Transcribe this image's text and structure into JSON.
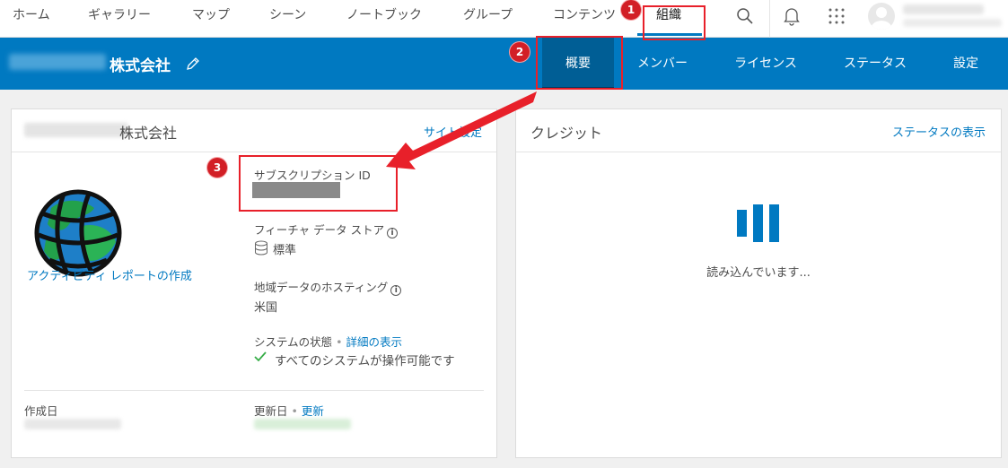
{
  "nav": {
    "items": [
      {
        "label": "ホーム",
        "name": "nav-home"
      },
      {
        "label": "ギャラリー",
        "name": "nav-gallery"
      },
      {
        "label": "マップ",
        "name": "nav-map"
      },
      {
        "label": "シーン",
        "name": "nav-scene"
      },
      {
        "label": "ノートブック",
        "name": "nav-notebook"
      },
      {
        "label": "グループ",
        "name": "nav-groups"
      },
      {
        "label": "コンテンツ",
        "name": "nav-content"
      },
      {
        "label": "組織",
        "name": "nav-organization"
      }
    ],
    "active": "組織",
    "icons": [
      "search-icon",
      "bell-icon",
      "apps-grid-icon"
    ]
  },
  "orgbar": {
    "org_name": "株式会社",
    "edit_icon": "pencil-icon",
    "tabs": [
      {
        "label": "概要",
        "active": true
      },
      {
        "label": "メンバー",
        "active": false
      },
      {
        "label": "ライセンス",
        "active": false
      },
      {
        "label": "ステータス",
        "active": false
      },
      {
        "label": "設定",
        "active": false
      }
    ]
  },
  "left_card": {
    "title": "株式会社",
    "site_settings_link": "サイト設定",
    "activity_link": "アクティビティ レポートの作成",
    "subscription_id_label": "サブスクリプション ID",
    "feature_store_label": "フィーチャ データ ストア",
    "feature_store_value": "標準",
    "hosting_label": "地域データのホスティング",
    "hosting_value": "米国",
    "system_status_label": "システムの状態",
    "system_status_link": "詳細の表示",
    "system_status_value": "すべてのシステムが操作可能です",
    "created_label": "作成日",
    "updated_label": "更新日",
    "update_link": "更新"
  },
  "right_card": {
    "title": "クレジット",
    "status_link": "ステータスの表示",
    "loading_text": "読み込んでいます..."
  },
  "annotations": [
    "1",
    "2",
    "3"
  ],
  "colors": {
    "brand_blue": "#0079c1",
    "active_tab": "#005e95",
    "annotation_red": "#e8202a"
  }
}
